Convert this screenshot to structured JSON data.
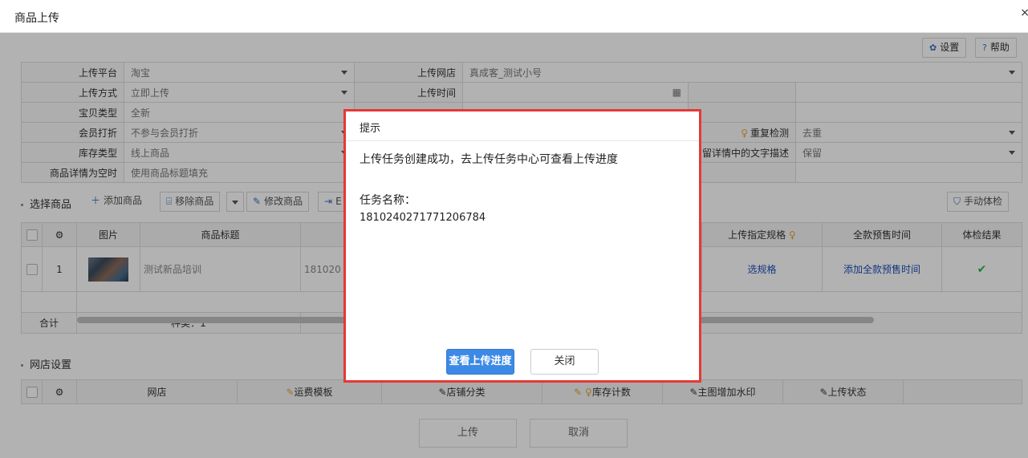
{
  "window": {
    "title": "商品上传",
    "close_glyph": "×"
  },
  "toolbar": {
    "settings_label": "设置",
    "settings_icon": "gear-icon",
    "help_label": "帮助",
    "help_icon": "question-icon"
  },
  "form": {
    "rows": [
      {
        "l1": "上传平台",
        "v1": "淘宝",
        "l2": "上传网店",
        "v2": "真成客_测试小号",
        "l3": "",
        "v3": ""
      },
      {
        "l1": "上传方式",
        "v1": "立即上传",
        "l2": "上传时间",
        "v2": "",
        "l3": "",
        "v3": ""
      },
      {
        "l1": "宝贝类型",
        "v1": "全新",
        "l2": "",
        "v2": "",
        "l3": "",
        "v3": ""
      },
      {
        "l1": "会员打折",
        "v1": "不参与会员打折",
        "l2": "",
        "v2": "",
        "l3": "重复检测",
        "v3": "去重"
      },
      {
        "l1": "库存类型",
        "v1": "线上商品",
        "l2": "",
        "v2": "",
        "l3": "留详情中的文字描述",
        "v3": "保留"
      },
      {
        "l1": "商品详情为空时",
        "v1": "使用商品标题填充",
        "l2": "",
        "v2": "",
        "l3": "",
        "v3": ""
      }
    ]
  },
  "select_products": {
    "title": "选择商品",
    "add": "添加商品",
    "remove": "移除商品",
    "edit": "修改商品",
    "more": "E",
    "check": "手动体检",
    "columns": {
      "image": "图片",
      "title": "商品标题",
      "spec": "上传指定规格",
      "presale": "全款预售时间",
      "result": "体检结果"
    },
    "row": {
      "index": "1",
      "title": "测试新品培训",
      "code": "181020",
      "spec_link": "选规格",
      "presale_link": "添加全款预售时间",
      "result_glyph": "✔"
    },
    "footer": {
      "total": "合计",
      "kinds": "种类：1"
    }
  },
  "shop_settings": {
    "title": "网店设置",
    "columns": {
      "shop": "网店",
      "freight": "运费模板",
      "category": "店铺分类",
      "stock": "库存计数",
      "watermark": "主图增加水印",
      "status": "上传状态"
    }
  },
  "bottom": {
    "upload": "上传",
    "cancel": "取消"
  },
  "dialog": {
    "title": "提示",
    "message": "上传任务创建成功，去上传任务中心可查看上传进度",
    "task_name_label": "任务名称：",
    "task_name_value": "1810240271771206784",
    "view_progress": "查看上传进度",
    "close": "关闭"
  },
  "colors": {
    "primary": "#3d8ae6",
    "highlight_border": "#e53935",
    "link": "#1c4fb8",
    "ok": "#2db34a"
  }
}
